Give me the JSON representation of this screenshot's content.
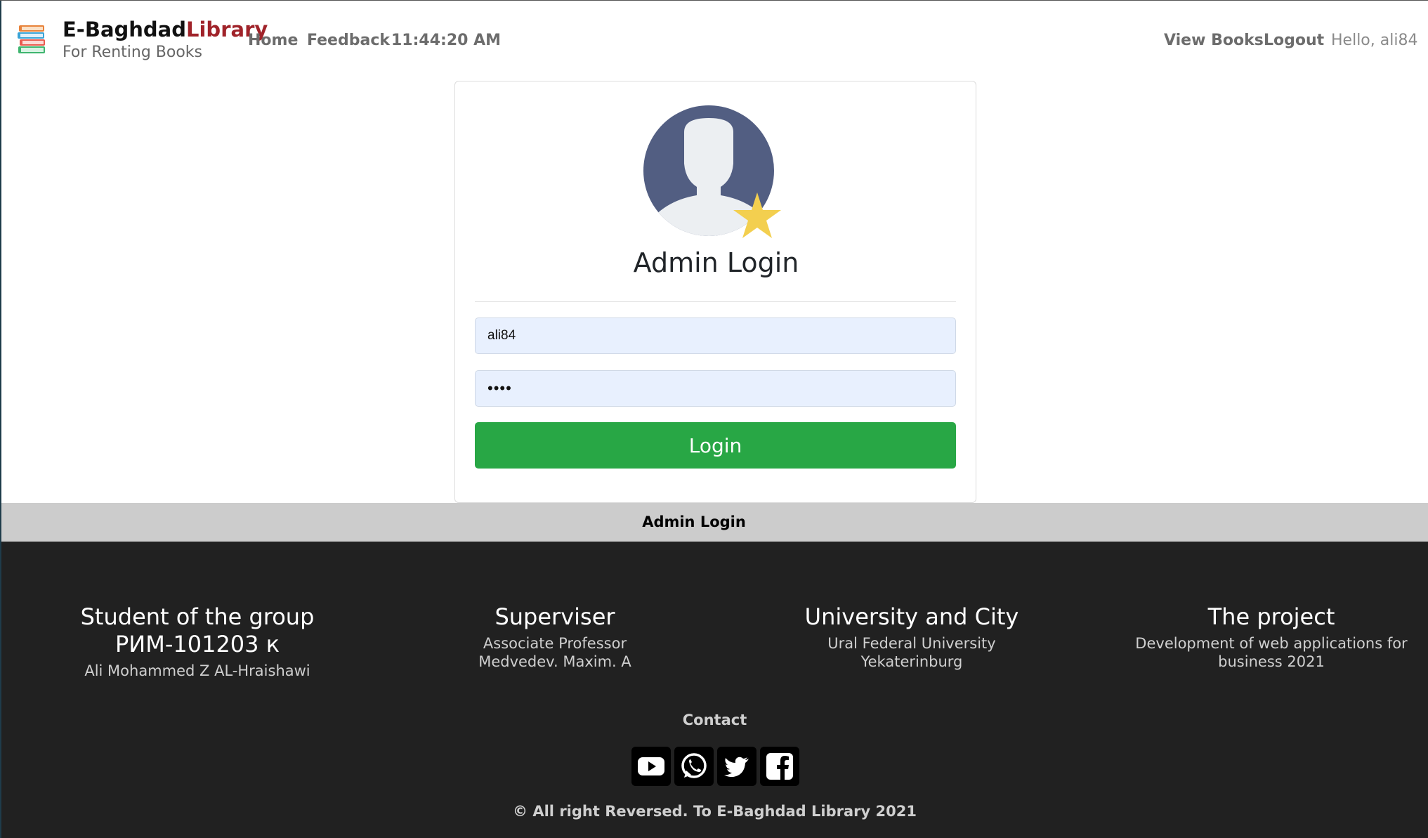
{
  "navbar": {
    "brand_main": "E-Baghdad",
    "brand_accent": "Library",
    "brand_subtitle": "For Renting Books",
    "links": {
      "home": "Home",
      "feedback": "Feedback",
      "view_books": "View Books",
      "logout": "Logout"
    },
    "clock": "11:44:20 AM",
    "greeting": "Hello, ali84"
  },
  "login_card": {
    "title": "Admin Login",
    "username_value": "ali84",
    "password_value": "••••",
    "button_label": "Login"
  },
  "status_bar": {
    "text": "Admin Login"
  },
  "footer": {
    "columns": [
      {
        "title_line1": "Student of the group",
        "title_line2": "РИМ-101203 к",
        "text": "Ali Mohammed Z AL-Hraishawi"
      },
      {
        "title": "Superviser",
        "line1": "Associate Professor",
        "line2": "Medvedev. Maxim. A"
      },
      {
        "title": "University and City",
        "line1": "Ural Federal University",
        "line2": "Yekaterinburg"
      },
      {
        "title": "The project",
        "line1": "Development of web applications for",
        "line2": "business 2021"
      }
    ],
    "contact_label": "Contact",
    "social_icons": [
      "youtube-icon",
      "whatsapp-icon",
      "twitter-icon",
      "facebook-icon"
    ],
    "copyright": "© All right Reversed. To E-Baghdad Library 2021"
  },
  "colors": {
    "accent_red": "#a0232a",
    "login_green": "#28a745",
    "footer_bg": "#212121",
    "status_bar_bg": "#cccccc",
    "avatar_bg": "#525e82",
    "star": "#f3cf4f"
  }
}
